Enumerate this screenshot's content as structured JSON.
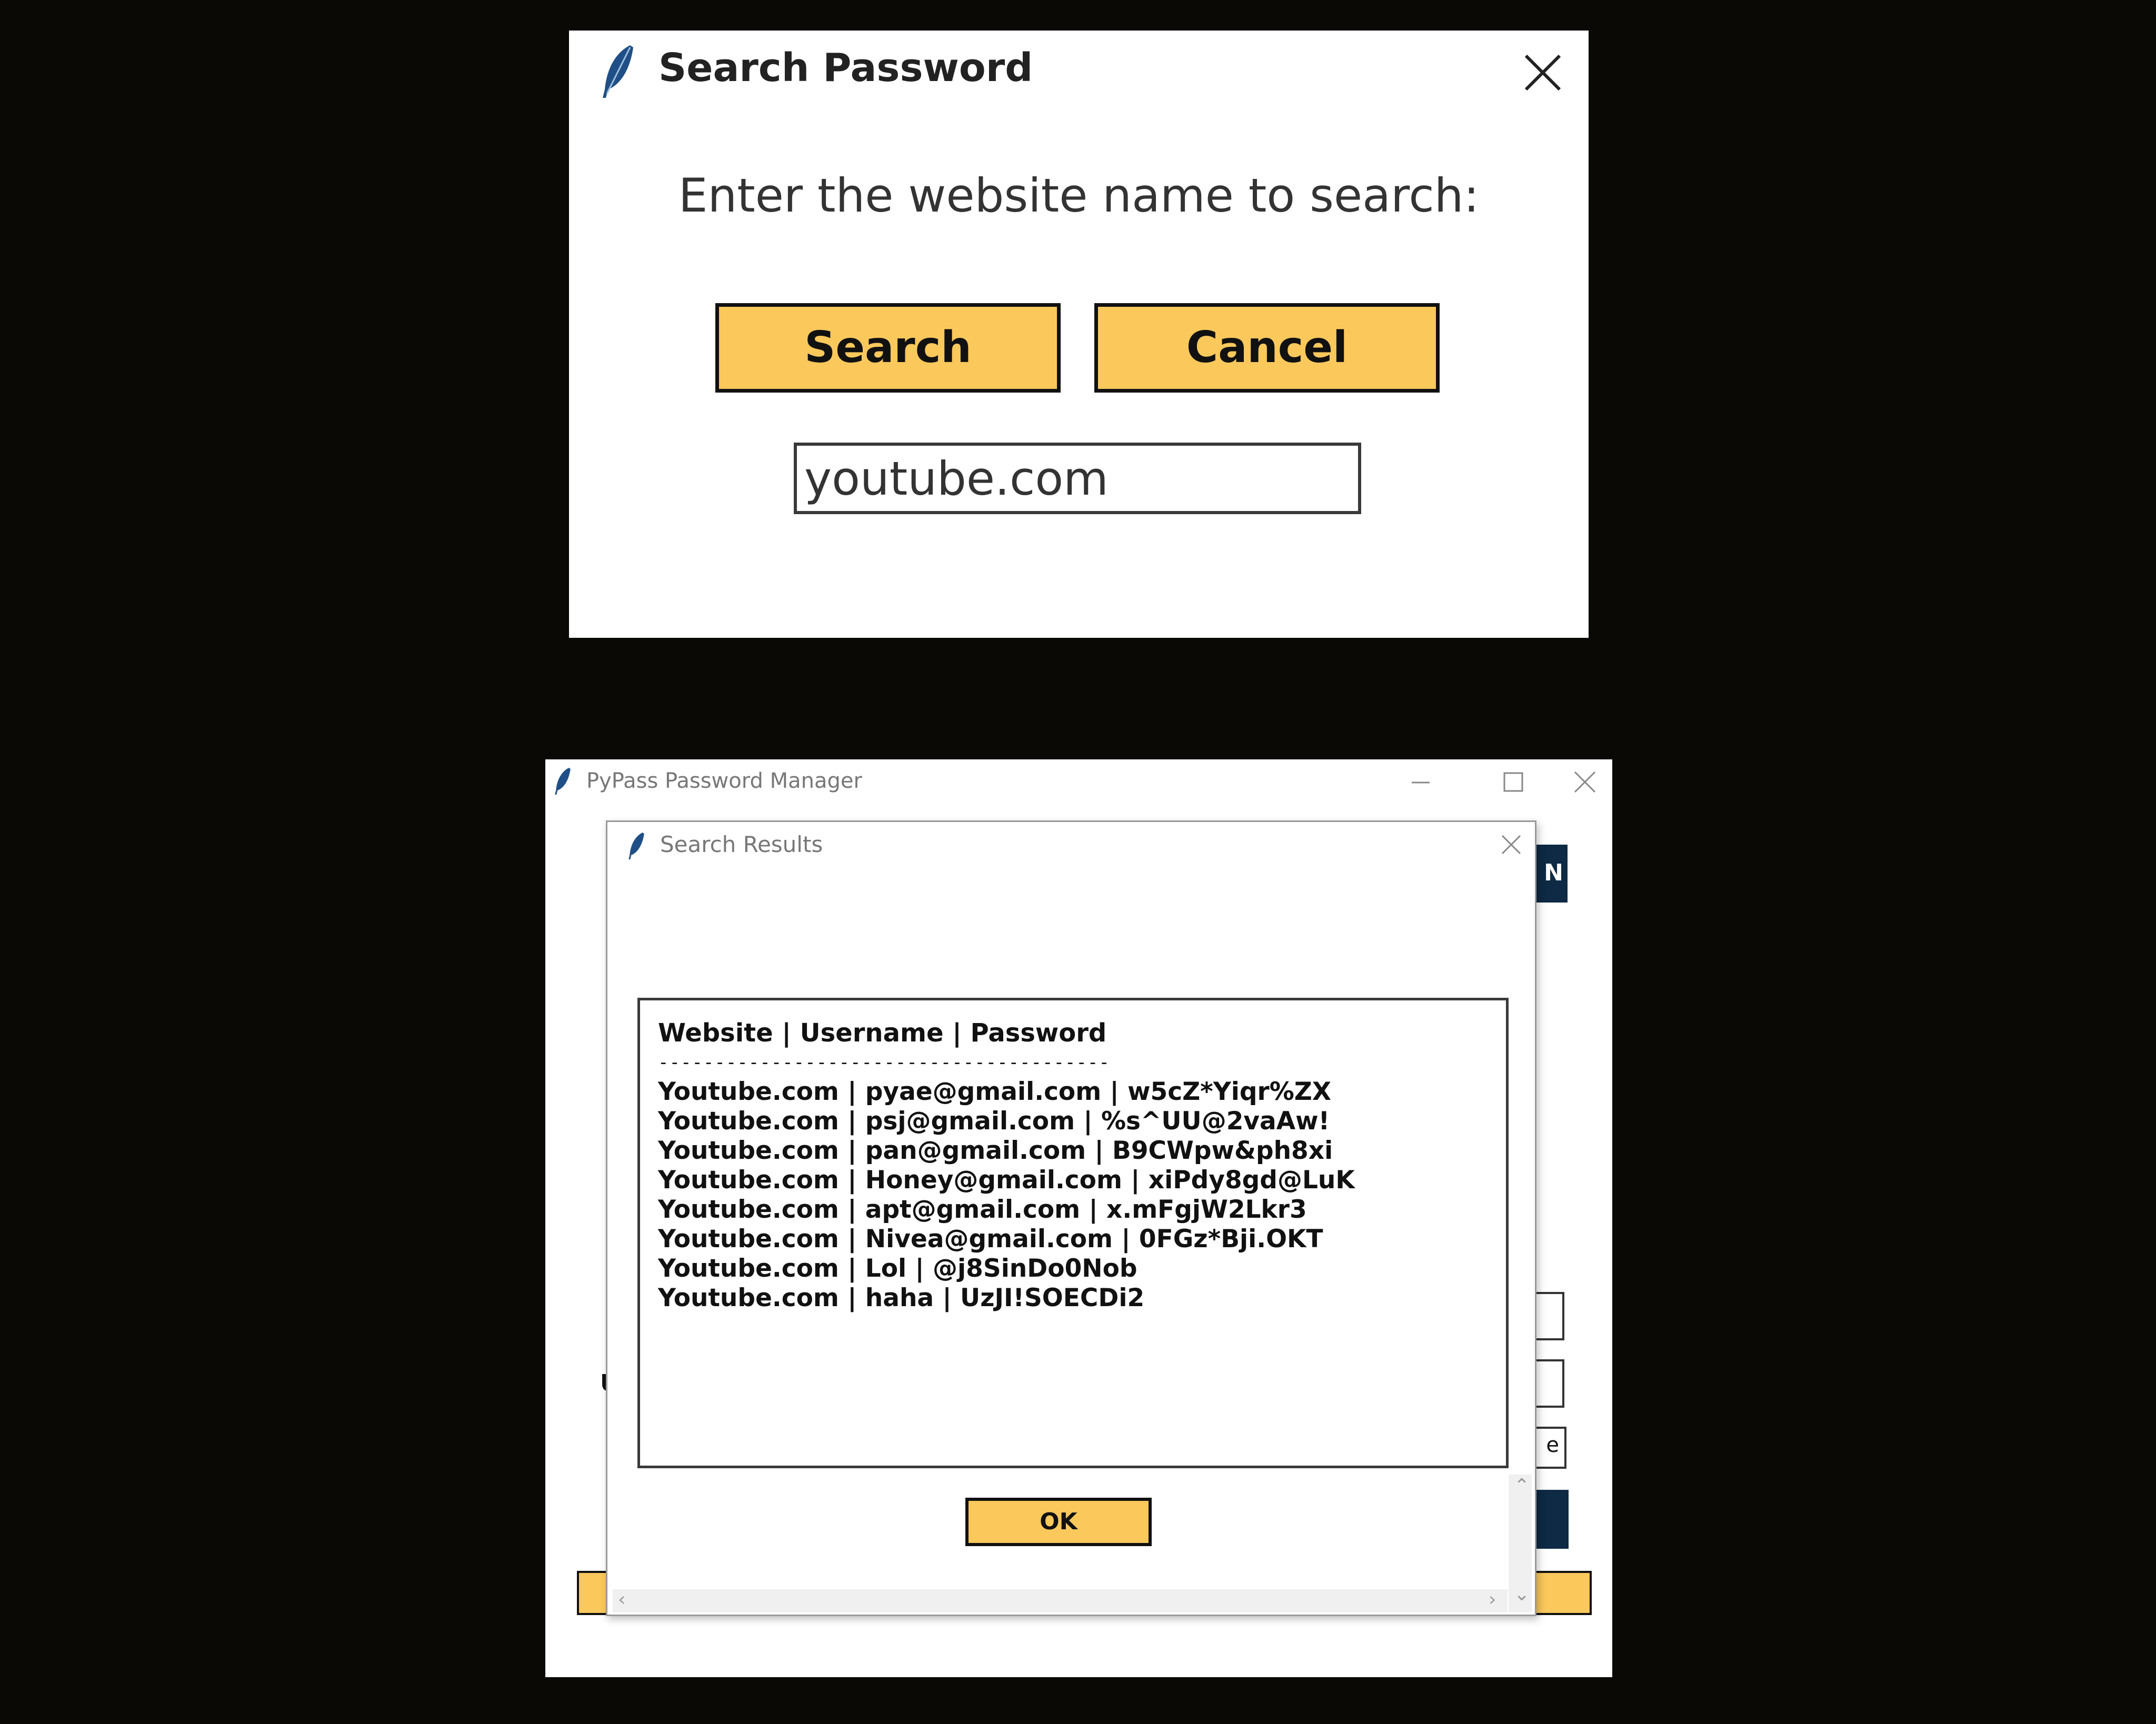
{
  "search_dialog": {
    "title": "Search Password",
    "prompt": "Enter the website name to search:",
    "search_button": "Search",
    "cancel_button": "Cancel",
    "website_input_value": "youtube.com"
  },
  "main_window": {
    "title": "PyPass Password Manager",
    "partial_button_text": "N",
    "partial_entry_text": "e",
    "partial_label_text": "U"
  },
  "results_dialog": {
    "title": "Search Results",
    "header": "Website | Username | Password",
    "separator": "----------------------------------------",
    "rows": [
      "Youtube.com | pyae@gmail.com | w5cZ*Yiqr%ZX",
      "Youtube.com | psj@gmail.com | %s^UU@2vaAw!",
      "Youtube.com | pan@gmail.com | B9CWpw&ph8xi",
      "Youtube.com | Honey@gmail.com | xiPdy8gd@LuK",
      "Youtube.com | apt@gmail.com | x.mFgjW2Lkr3",
      "Youtube.com | Nivea@gmail.com | 0FGz*Bji.OKT",
      "Youtube.com | Lol | @j8SinDo0Nob",
      "Youtube.com | haha | UzJI!SOECDi2"
    ],
    "ok_button": "OK"
  },
  "colors": {
    "background": "#0a0905",
    "button_yellow": "#fbc85c",
    "navy": "#0e2a44",
    "feather_blue": "#1f4f86"
  }
}
